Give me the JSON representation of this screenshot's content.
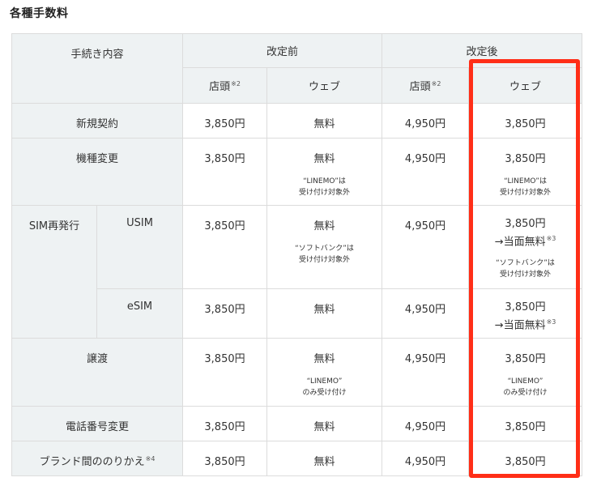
{
  "title": "各種手数料",
  "header": {
    "procedure": "手続き内容",
    "before": "改定前",
    "after": "改定後",
    "store": "店頭",
    "web": "ウェブ",
    "store_sup": "※2"
  },
  "rows": {
    "new_contract": {
      "label": "新規契約",
      "before_store": "3,850円",
      "before_web": "無料",
      "after_store": "4,950円",
      "after_web": "3,850円"
    },
    "model_change": {
      "label": "機種変更",
      "before_store": "3,850円",
      "before_web": "無料",
      "before_web_note_1": "“LINEMO”は",
      "before_web_note_2": "受け付け対象外",
      "after_store": "4,950円",
      "after_web": "3,850円",
      "after_web_note_1": "“LINEMO”は",
      "after_web_note_2": "受け付け対象外"
    },
    "sim_reissue": {
      "label": "SIM再発行",
      "usim": {
        "label": "USIM",
        "before_store": "3,850円",
        "before_web": "無料",
        "before_web_note_1": "“ソフトバンク”は",
        "before_web_note_2": "受け付け対象外",
        "after_store": "4,950円",
        "after_web": "3,850円",
        "after_web_line2": "→当面無料",
        "after_web_sup": "※3",
        "after_web_note_1": "“ソフトバンク”は",
        "after_web_note_2": "受け付け対象外"
      },
      "esim": {
        "label": "eSIM",
        "before_store": "3,850円",
        "before_web": "無料",
        "after_store": "4,950円",
        "after_web": "3,850円",
        "after_web_line2": "→当面無料",
        "after_web_sup": "※3"
      }
    },
    "transfer": {
      "label": "譲渡",
      "before_store": "3,850円",
      "before_web": "無料",
      "before_web_note_1": "“LINEMO”",
      "before_web_note_2": "のみ受け付け",
      "after_store": "4,950円",
      "after_web": "3,850円",
      "after_web_note_1": "“LINEMO”",
      "after_web_note_2": "のみ受け付け"
    },
    "number_change": {
      "label": "電話番号変更",
      "before_store": "3,850円",
      "before_web": "無料",
      "after_store": "4,950円",
      "after_web": "3,850円"
    },
    "brand_switch": {
      "label": "ブランド間ののりかえ",
      "label_sup": "※4",
      "before_store": "3,850円",
      "before_web": "無料",
      "after_store": "4,950円",
      "after_web": "3,850円"
    }
  },
  "colors": {
    "header_bg": "#eef2f3",
    "border": "#dcdcdc",
    "highlight": "#ff2e17"
  }
}
